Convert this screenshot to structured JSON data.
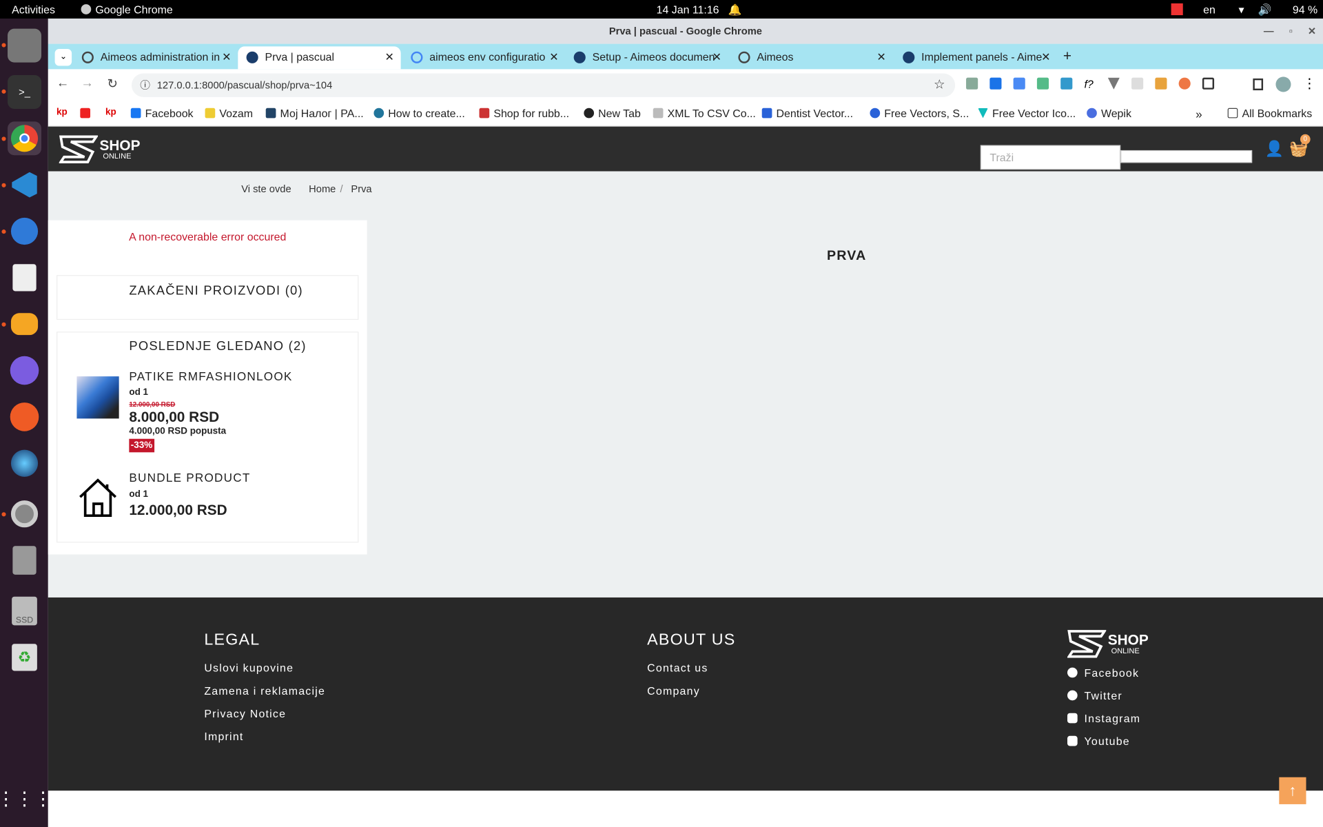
{
  "system": {
    "activities": "Activities",
    "app": "Google Chrome",
    "datetime": "14 Jan  11:16",
    "lang": "en",
    "battery": "94 %"
  },
  "window": {
    "title": "Prva | pascual - Google Chrome"
  },
  "tabs": [
    {
      "label": "Aimeos administration in"
    },
    {
      "label": "Prva | pascual"
    },
    {
      "label": "aimeos env configuratio"
    },
    {
      "label": "Setup - Aimeos documen"
    },
    {
      "label": "Aimeos"
    },
    {
      "label": "Implement panels - Aime"
    }
  ],
  "address": {
    "url": "127.0.0.1:8000/pascual/shop/prva~104"
  },
  "bookmarks": [
    "kp",
    "Facebook",
    "Vozam",
    "Мој Налог | РА...",
    "How to create...",
    "Shop for rubb...",
    "New Tab",
    "XML To CSV Co...",
    "Dentist Vector...",
    "Free Vectors, S...",
    "Free Vector Ico...",
    "Wepik",
    "All Bookmarks"
  ],
  "site": {
    "logo_main": "SHOP",
    "logo_sub": "ONLINE",
    "search_placeholder": "Traži",
    "basket_count": "0",
    "breadcrumb": {
      "intro": "Vi ste ovde",
      "home": "Home",
      "sep": "/",
      "current": "Prva"
    },
    "error": "A non-recoverable error occured",
    "pinned_title": "ZAKAČENI PROIZVODI (0)",
    "seen_title": "POSLEDNJE GLEDANO (2)",
    "products": [
      {
        "name": "PATIKE RMFASHIONLOOK",
        "from": "od 1",
        "old": "12.000,00 RSD",
        "price": "8.000,00 RSD",
        "discount": "4.000,00 RSD popusta",
        "badge": "-33%"
      },
      {
        "name": "BUNDLE PRODUCT",
        "from": "od 1",
        "price": "12.000,00 RSD"
      }
    ],
    "page_title": "PRVA"
  },
  "footer": {
    "legal_title": "LEGAL",
    "legal_links": [
      "Uslovi kupovine",
      "Zamena i reklamacije",
      "Privacy Notice",
      "Imprint"
    ],
    "about_title": "ABOUT US",
    "about_links": [
      "Contact us",
      "Company"
    ],
    "social": [
      "Facebook",
      "Twitter",
      "Instagram",
      "Youtube"
    ]
  },
  "colors": {
    "accent": "#c4172c",
    "tabstrip": "#a6e4f2",
    "header": "#2d2d2d",
    "footer": "#282828",
    "totop": "#f5a35a"
  }
}
